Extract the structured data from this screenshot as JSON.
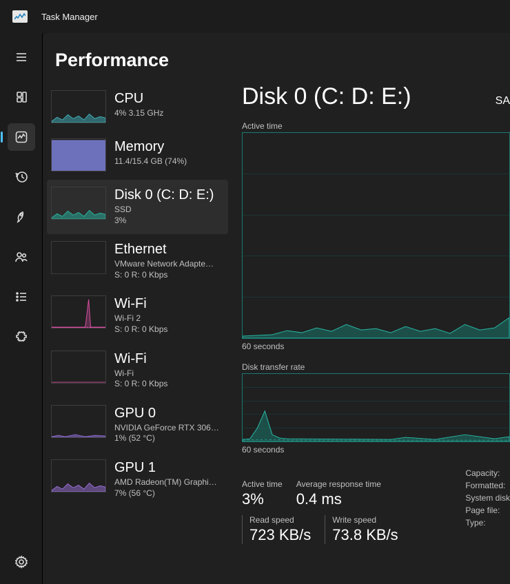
{
  "app": {
    "title": "Task Manager"
  },
  "page": {
    "title": "Performance"
  },
  "perf_items": [
    {
      "title": "CPU",
      "sub1": "4%  3.15 GHz",
      "sub2": "",
      "color": "#3fb0b9",
      "selected": false,
      "fill_style": "spark"
    },
    {
      "title": "Memory",
      "sub1": "11.4/15.4 GB (74%)",
      "sub2": "",
      "color": "#7b7fd6",
      "selected": false,
      "fill_style": "fill"
    },
    {
      "title": "Disk 0 (C: D: E:)",
      "sub1": "SSD",
      "sub2": "3%",
      "color": "#27b49f",
      "selected": true,
      "fill_style": "spark"
    },
    {
      "title": "Ethernet",
      "sub1": "VMware Network Adapte…",
      "sub2": "S: 0  R: 0 Kbps",
      "color": "#888",
      "selected": false,
      "fill_style": "none"
    },
    {
      "title": "Wi-Fi",
      "sub1": "Wi-Fi 2",
      "sub2": "S: 0  R: 0 Kbps",
      "color": "#d94fa4",
      "selected": false,
      "fill_style": "spike"
    },
    {
      "title": "Wi-Fi",
      "sub1": "Wi-Fi",
      "sub2": "S: 0  R: 0 Kbps",
      "color": "#d94fa4",
      "selected": false,
      "fill_style": "flat"
    },
    {
      "title": "GPU 0",
      "sub1": "NVIDIA GeForce RTX 306…",
      "sub2": "1%  (52 °C)",
      "color": "#886acb",
      "selected": false,
      "fill_style": "low"
    },
    {
      "title": "GPU 1",
      "sub1": "AMD Radeon(TM) Graphi…",
      "sub2": "7%  (56 °C)",
      "color": "#9a6fd8",
      "selected": false,
      "fill_style": "spark"
    }
  ],
  "detail": {
    "title": "Disk 0 (C: D: E:)",
    "model": "SA",
    "chart1_label": "Active time",
    "chart1_xlabel": "60 seconds",
    "chart2_label": "Disk transfer rate",
    "chart2_xlabel": "60 seconds",
    "metrics1": [
      {
        "label": "Active time",
        "value": "3%"
      },
      {
        "label": "Average response time",
        "value": "0.4 ms"
      }
    ],
    "metrics2": [
      {
        "label": "Read speed",
        "value": "723 KB/s"
      },
      {
        "label": "Write speed",
        "value": "73.8 KB/s"
      }
    ],
    "props": [
      "Capacity:",
      "Formatted:",
      "System disk",
      "Page file:",
      "Type:"
    ]
  },
  "chart_data": [
    {
      "type": "area",
      "title": "Active time",
      "xlabel": "60 seconds",
      "ylabel": "",
      "ylim": [
        0,
        100
      ],
      "x_seconds": [
        60,
        55,
        50,
        45,
        40,
        35,
        30,
        25,
        20,
        15,
        10,
        5,
        0
      ],
      "values_pct": [
        4,
        3,
        2,
        1,
        5,
        7,
        4,
        3,
        8,
        6,
        5,
        4,
        15
      ]
    },
    {
      "type": "line",
      "title": "Disk transfer rate",
      "xlabel": "60 seconds",
      "ylabel": "",
      "x_seconds": [
        60,
        55,
        50,
        45,
        40,
        35,
        30,
        25,
        20,
        15,
        10,
        5,
        0
      ],
      "series": [
        {
          "name": "Read",
          "values": [
            0,
            0,
            0,
            5,
            40,
            10,
            5,
            0,
            2,
            3,
            1,
            4,
            8
          ]
        },
        {
          "name": "Write",
          "values": [
            0,
            0,
            0,
            1,
            3,
            2,
            1,
            0,
            1,
            1,
            0,
            1,
            2
          ]
        }
      ]
    }
  ]
}
